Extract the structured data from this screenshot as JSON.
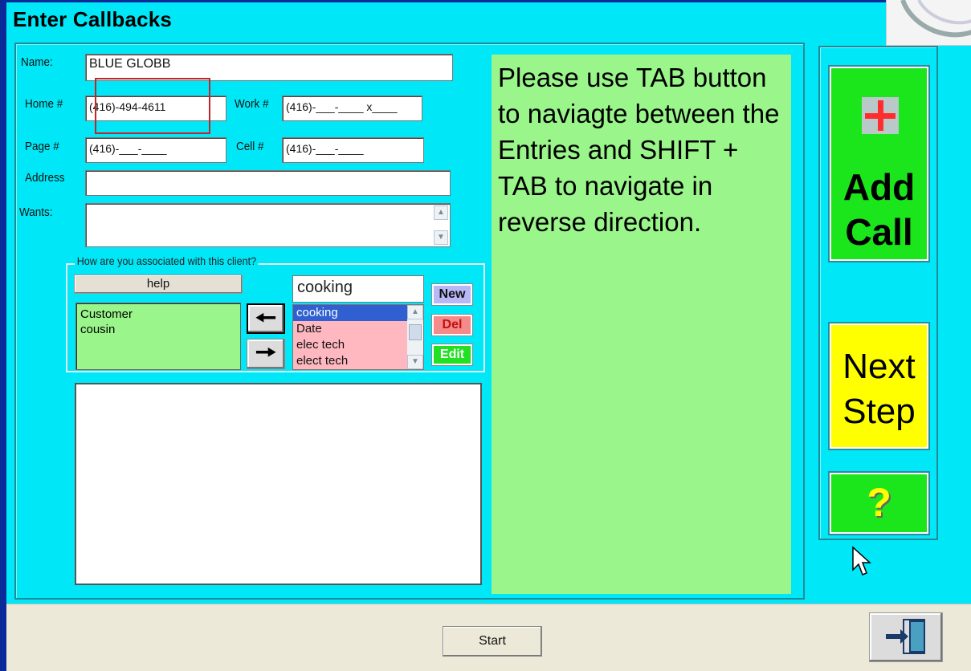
{
  "window": {
    "title": "Enter Callbacks"
  },
  "form": {
    "name_label": "Name:",
    "name_value": "BLUE GLOBB",
    "home_label": "Home #",
    "home_value": "(416)-494-4611",
    "work_label": "Work #",
    "work_value": "(416)-___-____ x____",
    "page_label": "Page #",
    "page_value": "(416)-___-____",
    "cell_label": "Cell #",
    "cell_value": "(416)-___-____",
    "address_label": "Address",
    "address_value": "",
    "wants_label": "Wants:",
    "wants_value": ""
  },
  "association": {
    "group_title": "How are you associated with this client?",
    "help_label": "help",
    "selected_list": [
      "Customer",
      "cousin"
    ],
    "combo_value": "cooking",
    "options": [
      "cooking",
      "Date",
      "elec tech",
      "elect tech"
    ],
    "selected_option_index": 0,
    "new_label": "New",
    "del_label": "Del",
    "edit_label": "Edit"
  },
  "info": {
    "message": "Please use TAB button to naviagte between the Entries and SHIFT + TAB to navigate in reverse direction."
  },
  "side_buttons": {
    "add_call_line1": "Add",
    "add_call_line2": "Call",
    "next_step_line1": "Next",
    "next_step_line2": "Step",
    "help_glyph": "?"
  },
  "footer": {
    "start_label": "Start"
  },
  "colors": {
    "window_bg": "#00e8f8",
    "panel_green": "#9af58a",
    "button_green": "#1be51b",
    "button_yellow": "#ffff00",
    "option_pink": "#ffb8c0",
    "highlight_red": "#c0252a"
  },
  "icons": [
    "plus-icon",
    "question-icon",
    "exit-door-icon",
    "arrow-left-icon",
    "arrow-right-icon",
    "chevron-up-icon",
    "chevron-down-icon",
    "mouse-cursor-icon"
  ]
}
